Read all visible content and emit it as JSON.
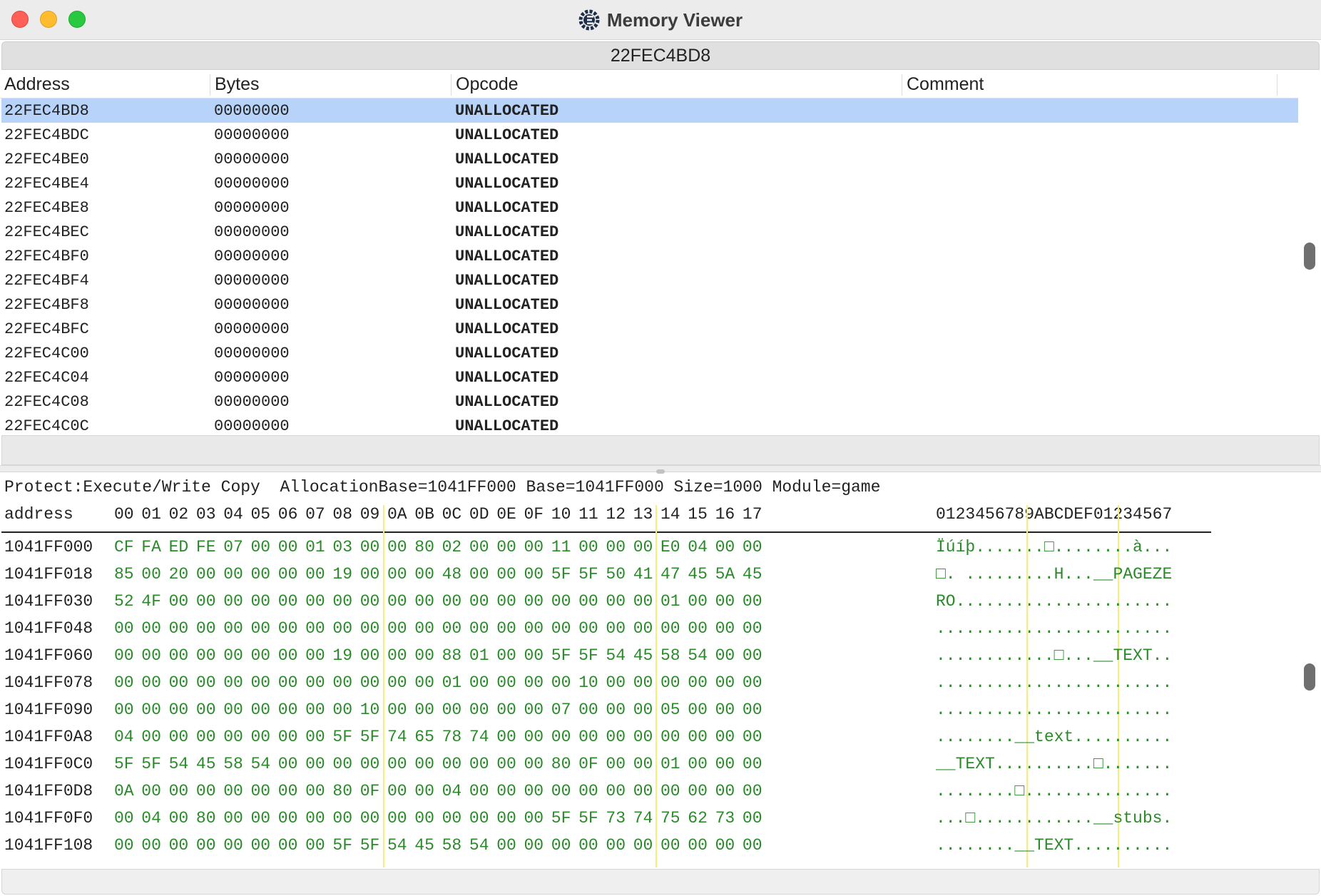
{
  "window": {
    "title": "Memory Viewer"
  },
  "address_bar": {
    "value": "22FEC4BD8"
  },
  "disassembler": {
    "columns": [
      "Address",
      "Bytes",
      "Opcode",
      "Comment"
    ],
    "rows": [
      {
        "address": "22FEC4BD8",
        "bytes": "00000000",
        "opcode": "UNALLOCATED",
        "selected": true
      },
      {
        "address": "22FEC4BDC",
        "bytes": "00000000",
        "opcode": "UNALLOCATED"
      },
      {
        "address": "22FEC4BE0",
        "bytes": "00000000",
        "opcode": "UNALLOCATED"
      },
      {
        "address": "22FEC4BE4",
        "bytes": "00000000",
        "opcode": "UNALLOCATED"
      },
      {
        "address": "22FEC4BE8",
        "bytes": "00000000",
        "opcode": "UNALLOCATED"
      },
      {
        "address": "22FEC4BEC",
        "bytes": "00000000",
        "opcode": "UNALLOCATED"
      },
      {
        "address": "22FEC4BF0",
        "bytes": "00000000",
        "opcode": "UNALLOCATED"
      },
      {
        "address": "22FEC4BF4",
        "bytes": "00000000",
        "opcode": "UNALLOCATED"
      },
      {
        "address": "22FEC4BF8",
        "bytes": "00000000",
        "opcode": "UNALLOCATED"
      },
      {
        "address": "22FEC4BFC",
        "bytes": "00000000",
        "opcode": "UNALLOCATED"
      },
      {
        "address": "22FEC4C00",
        "bytes": "00000000",
        "opcode": "UNALLOCATED"
      },
      {
        "address": "22FEC4C04",
        "bytes": "00000000",
        "opcode": "UNALLOCATED"
      },
      {
        "address": "22FEC4C08",
        "bytes": "00000000",
        "opcode": "UNALLOCATED"
      },
      {
        "address": "22FEC4C0C",
        "bytes": "00000000",
        "opcode": "UNALLOCATED"
      }
    ]
  },
  "hex_view": {
    "info": "Protect:Execute/Write Copy  AllocationBase=1041FF000 Base=1041FF000 Size=1000 Module=game",
    "address_header": "address",
    "byte_headers": [
      "00",
      "01",
      "02",
      "03",
      "04",
      "05",
      "06",
      "07",
      "08",
      "09",
      "0A",
      "0B",
      "0C",
      "0D",
      "0E",
      "0F",
      "10",
      "11",
      "12",
      "13",
      "14",
      "15",
      "16",
      "17"
    ],
    "text_header": "0123456789ABCDEF01234567",
    "rows": [
      {
        "address": "1041FF000",
        "bytes": [
          "CF",
          "FA",
          "ED",
          "FE",
          "07",
          "00",
          "00",
          "01",
          "03",
          "00",
          "00",
          "80",
          "02",
          "00",
          "00",
          "00",
          "11",
          "00",
          "00",
          "00",
          "E0",
          "04",
          "00",
          "00"
        ],
        "text": "Ïúíþ.......□........à..."
      },
      {
        "address": "1041FF018",
        "bytes": [
          "85",
          "00",
          "20",
          "00",
          "00",
          "00",
          "00",
          "00",
          "19",
          "00",
          "00",
          "00",
          "48",
          "00",
          "00",
          "00",
          "5F",
          "5F",
          "50",
          "41",
          "47",
          "45",
          "5A",
          "45"
        ],
        "text": "□. .........H...__PAGEZE"
      },
      {
        "address": "1041FF030",
        "bytes": [
          "52",
          "4F",
          "00",
          "00",
          "00",
          "00",
          "00",
          "00",
          "00",
          "00",
          "00",
          "00",
          "00",
          "00",
          "00",
          "00",
          "00",
          "00",
          "00",
          "00",
          "01",
          "00",
          "00",
          "00"
        ],
        "text": "RO......................"
      },
      {
        "address": "1041FF048",
        "bytes": [
          "00",
          "00",
          "00",
          "00",
          "00",
          "00",
          "00",
          "00",
          "00",
          "00",
          "00",
          "00",
          "00",
          "00",
          "00",
          "00",
          "00",
          "00",
          "00",
          "00",
          "00",
          "00",
          "00",
          "00"
        ],
        "text": "........................"
      },
      {
        "address": "1041FF060",
        "bytes": [
          "00",
          "00",
          "00",
          "00",
          "00",
          "00",
          "00",
          "00",
          "19",
          "00",
          "00",
          "00",
          "88",
          "01",
          "00",
          "00",
          "5F",
          "5F",
          "54",
          "45",
          "58",
          "54",
          "00",
          "00"
        ],
        "text": "............□...__TEXT.."
      },
      {
        "address": "1041FF078",
        "bytes": [
          "00",
          "00",
          "00",
          "00",
          "00",
          "00",
          "00",
          "00",
          "00",
          "00",
          "00",
          "00",
          "01",
          "00",
          "00",
          "00",
          "00",
          "10",
          "00",
          "00",
          "00",
          "00",
          "00",
          "00"
        ],
        "text": "........................"
      },
      {
        "address": "1041FF090",
        "bytes": [
          "00",
          "00",
          "00",
          "00",
          "00",
          "00",
          "00",
          "00",
          "00",
          "10",
          "00",
          "00",
          "00",
          "00",
          "00",
          "00",
          "07",
          "00",
          "00",
          "00",
          "05",
          "00",
          "00",
          "00"
        ],
        "text": "........................"
      },
      {
        "address": "1041FF0A8",
        "bytes": [
          "04",
          "00",
          "00",
          "00",
          "00",
          "00",
          "00",
          "00",
          "5F",
          "5F",
          "74",
          "65",
          "78",
          "74",
          "00",
          "00",
          "00",
          "00",
          "00",
          "00",
          "00",
          "00",
          "00",
          "00"
        ],
        "text": "........__text.........."
      },
      {
        "address": "1041FF0C0",
        "bytes": [
          "5F",
          "5F",
          "54",
          "45",
          "58",
          "54",
          "00",
          "00",
          "00",
          "00",
          "00",
          "00",
          "00",
          "00",
          "00",
          "00",
          "80",
          "0F",
          "00",
          "00",
          "01",
          "00",
          "00",
          "00"
        ],
        "text": "__TEXT..........□......."
      },
      {
        "address": "1041FF0D8",
        "bytes": [
          "0A",
          "00",
          "00",
          "00",
          "00",
          "00",
          "00",
          "00",
          "80",
          "0F",
          "00",
          "00",
          "04",
          "00",
          "00",
          "00",
          "00",
          "00",
          "00",
          "00",
          "00",
          "00",
          "00",
          "00"
        ],
        "text": "........□..............."
      },
      {
        "address": "1041FF0F0",
        "bytes": [
          "00",
          "04",
          "00",
          "80",
          "00",
          "00",
          "00",
          "00",
          "00",
          "00",
          "00",
          "00",
          "00",
          "00",
          "00",
          "00",
          "5F",
          "5F",
          "73",
          "74",
          "75",
          "62",
          "73",
          "00"
        ],
        "text": "...□............__stubs."
      },
      {
        "address": "1041FF108",
        "bytes": [
          "00",
          "00",
          "00",
          "00",
          "00",
          "00",
          "00",
          "00",
          "5F",
          "5F",
          "54",
          "45",
          "58",
          "54",
          "00",
          "00",
          "00",
          "00",
          "00",
          "00",
          "00",
          "00",
          "00",
          "00"
        ],
        "text": "........__TEXT.........."
      }
    ]
  }
}
